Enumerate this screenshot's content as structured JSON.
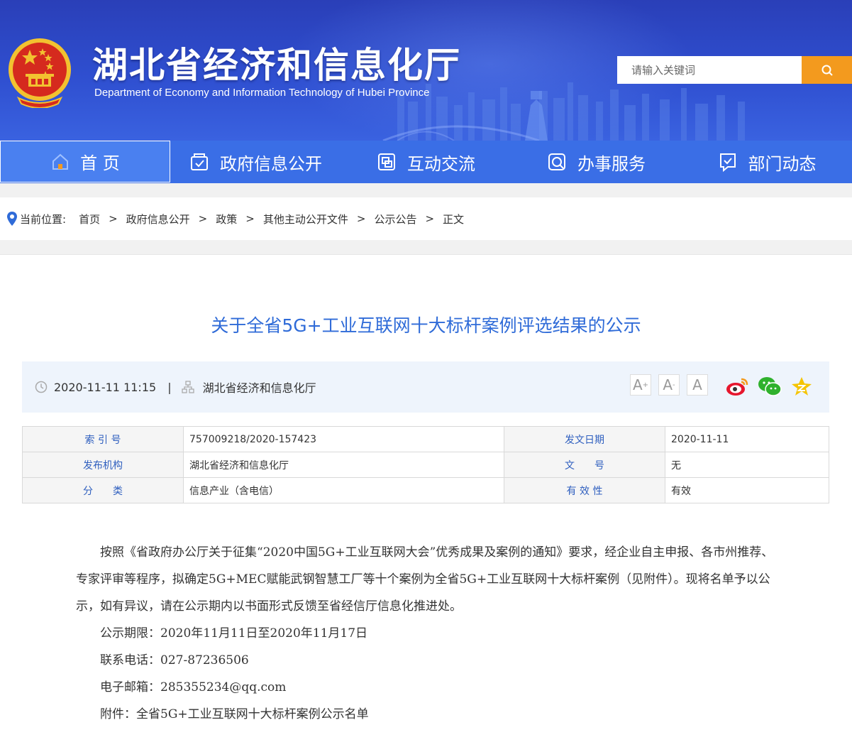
{
  "header": {
    "title": "湖北省经济和信息化厅",
    "subtitle": "Department of Economy and Information Technology of Hubei Province",
    "search_placeholder": "请输入关键词"
  },
  "nav": {
    "items": [
      {
        "label": "首 页",
        "icon": "home-icon"
      },
      {
        "label": "政府信息公开",
        "icon": "info-icon"
      },
      {
        "label": "互动交流",
        "icon": "chat-icon"
      },
      {
        "label": "办事服务",
        "icon": "service-icon"
      },
      {
        "label": "部门动态",
        "icon": "news-icon"
      }
    ]
  },
  "breadcrumb": {
    "prefix": "当前位置:",
    "items": [
      "首页",
      "政府信息公开",
      "政策",
      "其他主动公开文件",
      "公示公告",
      "正文"
    ],
    "separator": ">"
  },
  "article": {
    "title": "关于全省5G+工业互联网十大标杆案例评选结果的公示",
    "datetime": "2020-11-11 11:15",
    "divider": "|",
    "source": "湖北省经济和信息化厅",
    "font_buttons": [
      "A",
      "A",
      "A"
    ],
    "font_superscripts": [
      "+",
      "-"
    ]
  },
  "info_table": {
    "rows": [
      {
        "k1": "索 引 号",
        "v1": "757009218/2020-157423",
        "k2": "发文日期",
        "v2": "2020-11-11"
      },
      {
        "k1": "发布机构",
        "v1": "湖北省经济和信息化厅",
        "k2": "文　　号",
        "v2": "无"
      },
      {
        "k1": "分　　类",
        "v1": "信息产业（含电信）",
        "k2": "有 效 性",
        "v2": "有效"
      }
    ]
  },
  "body": {
    "paragraphs": [
      "按照《省政府办公厅关于征集“2020中国5G+工业互联网大会”优秀成果及案例的通知》要求，经企业自主申报、各市州推荐、专家评审等程序，拟确定5G+MEC赋能武钢智慧工厂等十个案例为全省5G+工业互联网十大标杆案例（见附件）。现将名单予以公示，如有异议，请在公示期内以书面形式反馈至省经信厅信息化推进处。",
      "公示期限：2020年11月11日至2020年11月17日",
      "联系电话：027-87236506",
      "电子邮箱：285355234@qq.com",
      "附件：全省5G+工业互联网十大标杆案例公示名单"
    ]
  },
  "colors": {
    "banner": "#2f4fd0",
    "nav": "#3a6ee6",
    "search_button": "#f39a1e",
    "title": "#2f6bd8"
  }
}
